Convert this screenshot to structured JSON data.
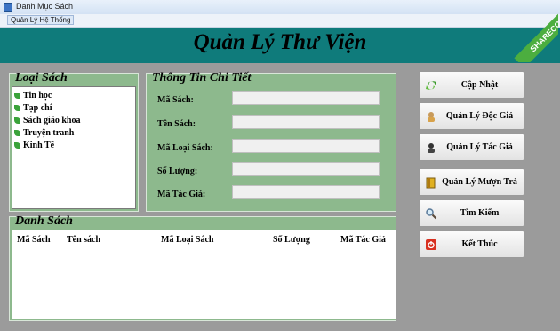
{
  "window": {
    "title": "Danh Mục Sách"
  },
  "menu": {
    "item": "Quản Lý Hệ Thống"
  },
  "header": {
    "title": "Quản Lý Thư Viện"
  },
  "watermark": {
    "text": "SHARECODE.vn"
  },
  "categories": {
    "legend": "Loại Sách",
    "items": [
      "Tin học",
      "Tạp chí",
      "Sách giáo khoa",
      "Truyện tranh",
      "Kinh Tế"
    ]
  },
  "details": {
    "legend": "Thông Tin Chi  Tiết",
    "fields": [
      {
        "label": "Mã Sách:",
        "value": ""
      },
      {
        "label": "Tên Sách:",
        "value": ""
      },
      {
        "label": "Mã Loại Sách:",
        "value": ""
      },
      {
        "label": "Số Lượng:",
        "value": ""
      },
      {
        "label": "Mã Tác Giả:",
        "value": ""
      }
    ]
  },
  "list": {
    "legend": "Danh Sách",
    "columns": [
      "Mã Sách",
      "Tên sách",
      "Mã Loại Sách",
      "Số Lượng",
      "Mã Tác Giả"
    ]
  },
  "buttons": [
    {
      "label": "Cập Nhật",
      "icon": "refresh-icon"
    },
    {
      "label": "Quản Lý Độc Giả",
      "icon": "reader-icon"
    },
    {
      "label": "Quản Lý Tác Giả",
      "icon": "author-icon"
    },
    {
      "label": "Quản Lý Mượn Trả",
      "icon": "book-icon"
    },
    {
      "label": "Tìm Kiếm",
      "icon": "magnifier-icon"
    },
    {
      "label": "Kết Thúc",
      "icon": "power-icon"
    }
  ]
}
